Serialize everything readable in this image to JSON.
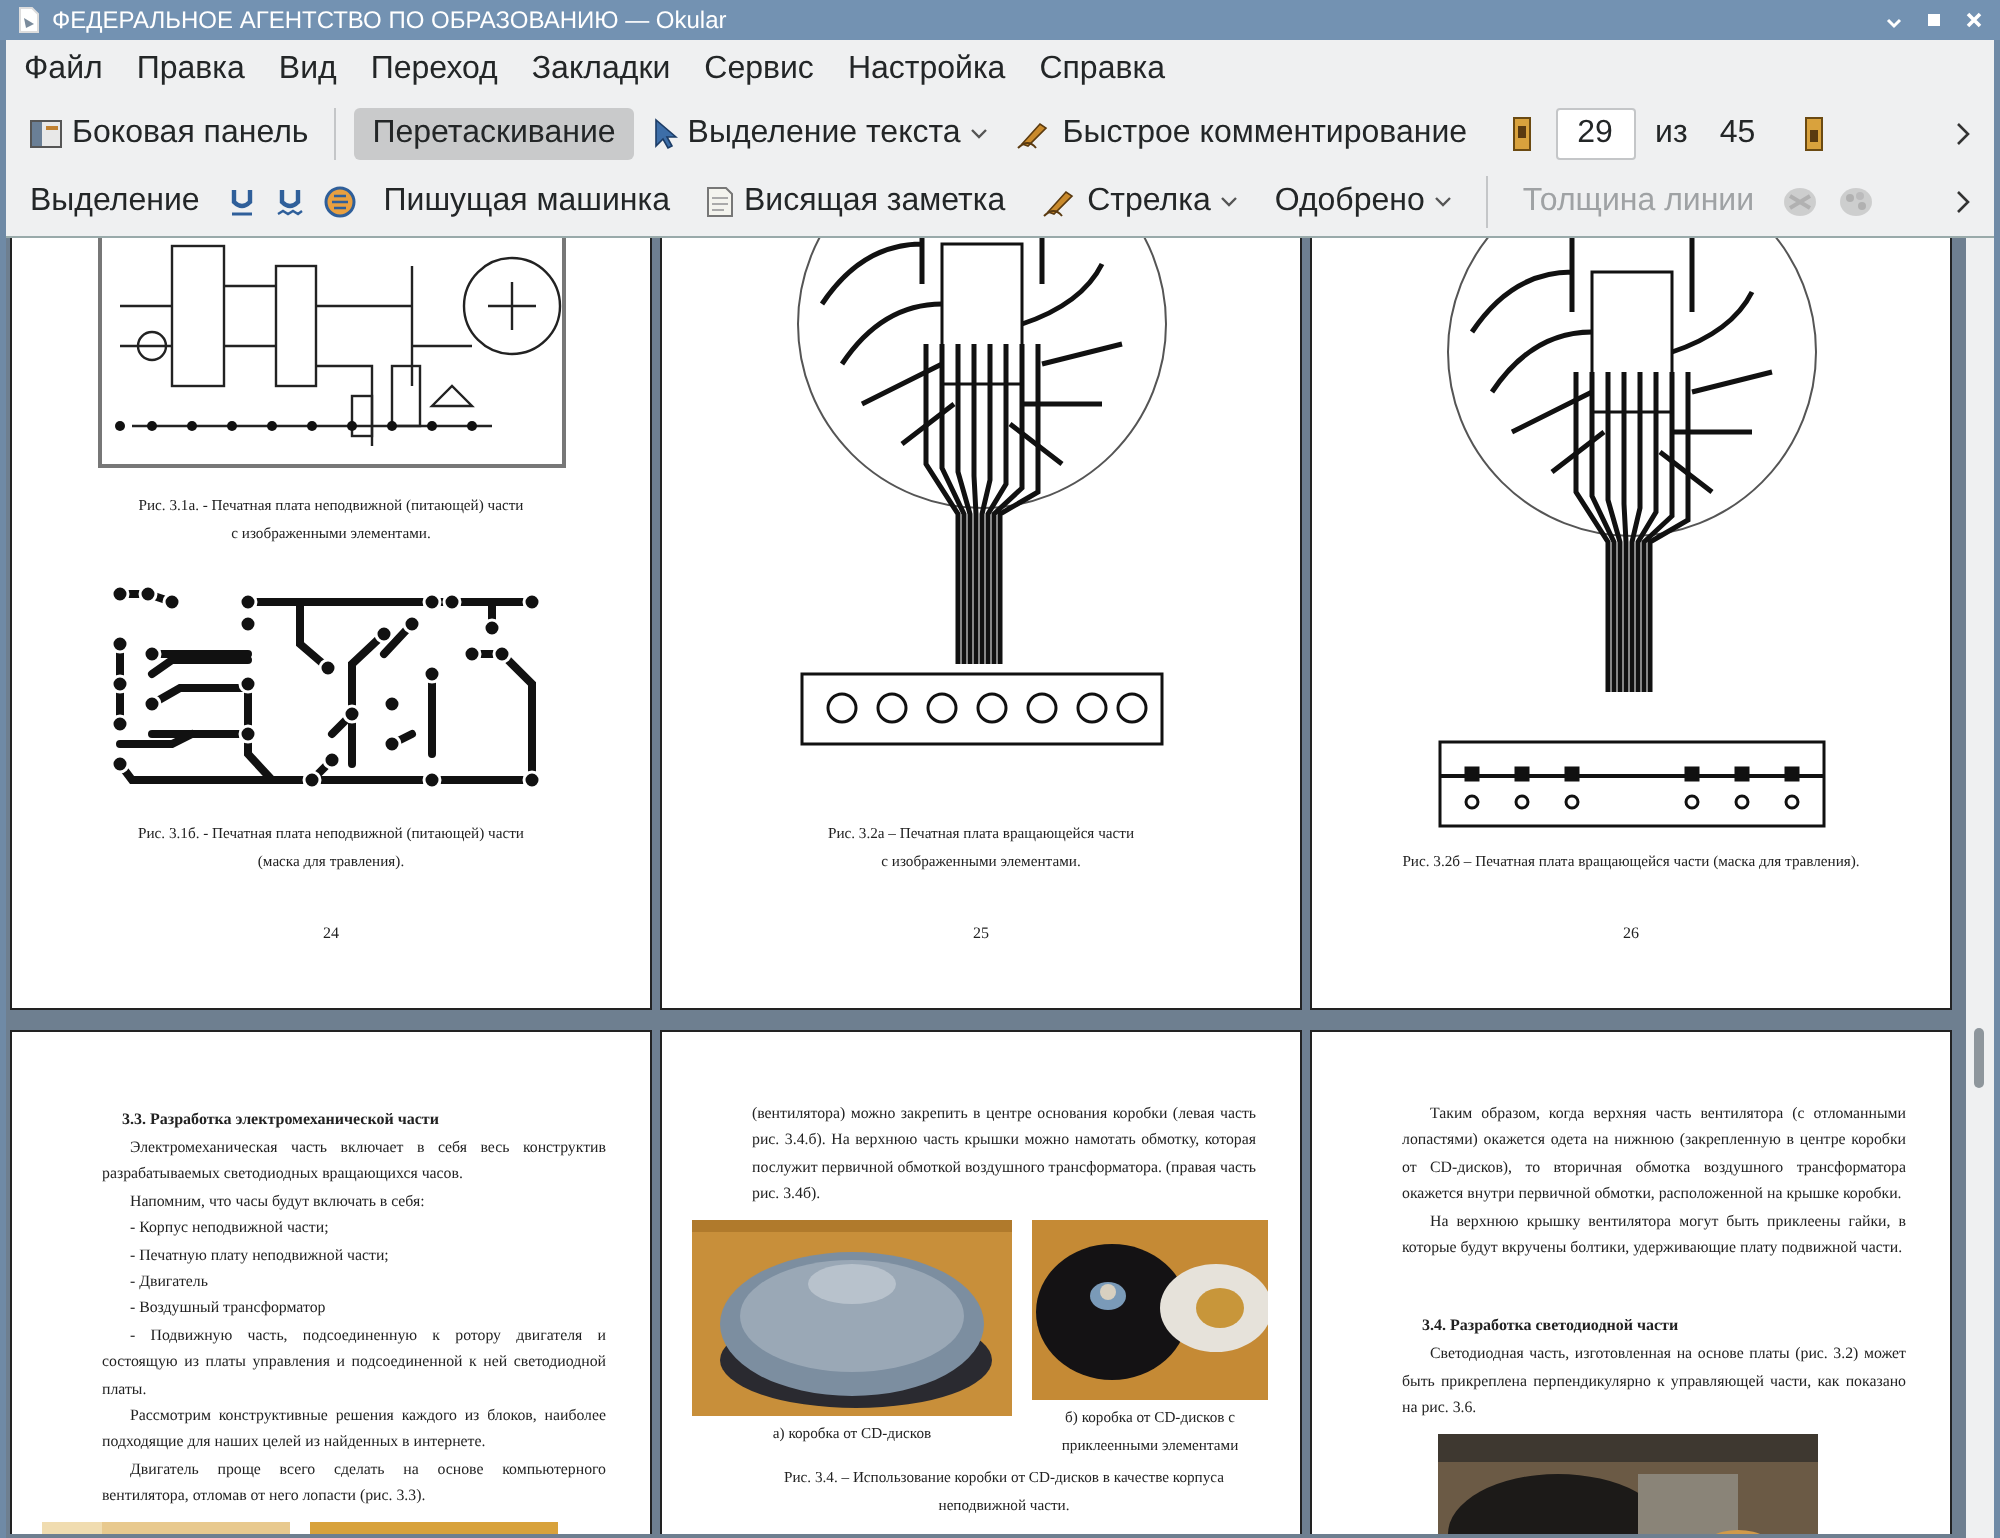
{
  "window": {
    "title": "ФЕДЕРАЛЬНОЕ АГЕНТСТВО ПО ОБРАЗОВАНИЮ  — Okular"
  },
  "menu": [
    "Файл",
    "Правка",
    "Вид",
    "Переход",
    "Закладки",
    "Сервис",
    "Настройка",
    "Справка"
  ],
  "toolbar": [
    {
      "kind": "sidebar",
      "label": "Боковая панель",
      "selected": false
    },
    {
      "kind": "plain",
      "label": "Перетаскивание",
      "selected": true
    },
    {
      "kind": "select",
      "label": "Выделение текста",
      "selected": false
    },
    {
      "kind": "annotate",
      "label": "Быстрое комментирование",
      "selected": false
    }
  ],
  "page_nav": {
    "current": "29",
    "of": "из",
    "total": "45"
  },
  "annotation_toolbar": [
    {
      "kind": "plain",
      "label": "Выделение",
      "disabled": false
    },
    {
      "kind": "underline",
      "disabled": false
    },
    {
      "kind": "squiggle",
      "disabled": false
    },
    {
      "kind": "circle",
      "disabled": false
    },
    {
      "kind": "plain",
      "label": "Пишущая машинка",
      "disabled": false
    },
    {
      "kind": "note",
      "label": "Висящая заметка",
      "disabled": false
    },
    {
      "kind": "pen",
      "label": "Стрелка",
      "disabled": false
    },
    {
      "kind": "dropdown",
      "label": "Одобрено",
      "disabled": false
    },
    {
      "kind": "separator"
    },
    {
      "kind": "plain",
      "label": "Толщина линии",
      "disabled": true
    },
    {
      "kind": "stamp",
      "disabled": true
    },
    {
      "kind": "palette",
      "disabled": true
    }
  ],
  "pages_top": [
    {
      "page_number": "24",
      "blocks": [
        {
          "kind": "board-parts"
        },
        {
          "kind": "caption",
          "lines": [
            "Рис. 3.1а. - Печатная плата неподвижной (питающей) части",
            "с изображенными элементами."
          ]
        },
        {
          "kind": "board-mask"
        },
        {
          "kind": "caption",
          "lines": [
            "Рис. 3.1б. - Печатная плата неподвижной (питающей) части",
            "(маска для травления)."
          ]
        }
      ]
    },
    {
      "page_number": "25",
      "blocks": [
        {
          "kind": "round-board"
        },
        {
          "kind": "caption",
          "lines": [
            "Рис. 3.2а – Печатная плата вращающейся части",
            "с изображенными элементами."
          ]
        }
      ]
    },
    {
      "page_number": "26",
      "blocks": [
        {
          "kind": "round-board-mask"
        },
        {
          "kind": "caption",
          "lines": [
            "Рис. 3.2б – Печатная плата вращающейся части (маска для травления)."
          ]
        }
      ]
    }
  ],
  "pages_bottom": [
    {
      "blocks": [
        {
          "kind": "heading",
          "text": "3.3. Разработка электромеханической части"
        },
        {
          "kind": "paragraph",
          "text": "Электромеханическая часть включает в себя весь конструктив разрабатываемых светодиодных вращающихся часов."
        },
        {
          "kind": "paragraph",
          "text": "Напомним, что часы будут включать в себя:"
        },
        {
          "kind": "paragraph",
          "text": "- Корпус неподвижной части;"
        },
        {
          "kind": "paragraph",
          "text": "- Печатную плату неподвижной части;"
        },
        {
          "kind": "paragraph",
          "text": "- Двигатель"
        },
        {
          "kind": "paragraph",
          "text": "- Воздушный трансформатор"
        },
        {
          "kind": "paragraph",
          "text": "- Подвижную часть, подсоединенную к ротору двигателя и состоящую из платы управления и подсоединенной к ней светодиодной платы."
        },
        {
          "kind": "paragraph",
          "text": "Рассмотрим конструктивные решения каждого из блоков, наиболее подходящие для наших целей из найденных в интернете."
        },
        {
          "kind": "paragraph",
          "text": "Двигатель проще всего сделать на основе компьютерного вентилятора, отломав от него лопасти (рис. 3.3)."
        },
        {
          "kind": "photos"
        }
      ]
    },
    {
      "blocks": [
        {
          "kind": "continued",
          "text": "(вентилятора) можно закрепить в центре основания коробки (левая часть рис. 3.4.б). На верхнюю часть крышки можно намотать обмотку, которая послужит первичной обмоткой воздушного трансформатора. (правая часть рис. 3.4б)."
        },
        {
          "kind": "photos",
          "items": [
            {
              "kind": "picture",
              "caption": "а) коробка от CD-дисков"
            },
            {
              "kind": "picture",
              "caption": "б) коробка от CD-дисков с приклеенными элементами"
            }
          ]
        },
        {
          "kind": "caption",
          "lines": [
            "Рис. 3.4. – Использование коробки от CD-дисков в качестве корпуса",
            "неподвижной части."
          ]
        }
      ]
    },
    {
      "blocks": [
        {
          "kind": "paragraph",
          "text": "Таким образом, когда верхняя часть вентилятора (с отломанными лопастями) окажется одета на нижнюю (закрепленную в центре коробки от CD-дисков), то вторичная обмотка воздушного трансформатора окажется внутри первичной обмотки, расположенной на крышке коробки."
        },
        {
          "kind": "paragraph",
          "text": "На верхнюю крышку вентилятора могут быть приклеены гайки, в которые будут вкручены болтики, удерживающие плату подвижной части."
        },
        {
          "kind": "heading",
          "text": "3.4. Разработка светодиодной части"
        },
        {
          "kind": "paragraph",
          "text": "Светодиодная часть, изготовленная на основе платы (рис. 3.2) может быть прикреплена перпендикулярно к управляющей части, как показано на рис. 3.6."
        },
        {
          "kind": "photos"
        }
      ]
    }
  ]
}
